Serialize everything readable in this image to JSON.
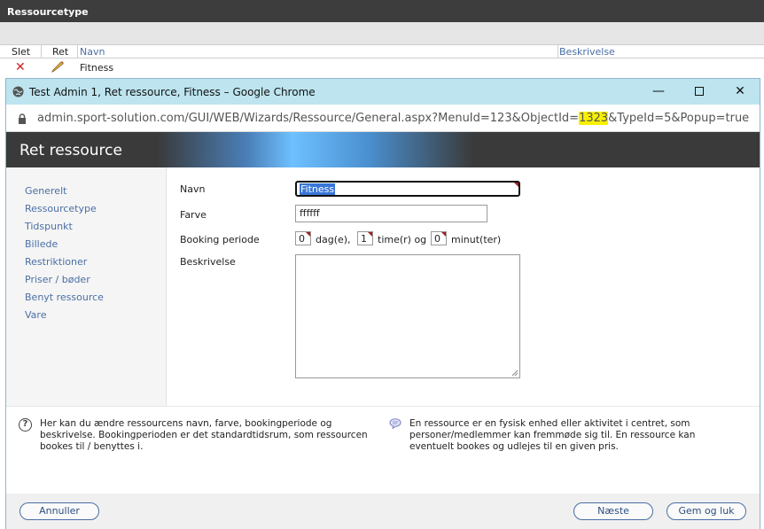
{
  "background": {
    "header_title": "Ressourcetype",
    "columns": {
      "slet": "Slet",
      "ret": "Ret",
      "navn": "Navn",
      "beskrivelse": "Beskrivelse"
    },
    "row": {
      "name": "Fitness"
    }
  },
  "window": {
    "title": "Test Admin 1, Ret ressource, Fitness – Google Chrome",
    "url_before": "admin.sport-solution.com/GUI/WEB/Wizards/Ressource/General.aspx?MenuId=123&ObjectId=",
    "url_highlight": "1323",
    "url_after": "&TypeId=5&Popup=true"
  },
  "modal": {
    "title": "Ret ressource",
    "nav": [
      "Generelt",
      "Ressourcetype",
      "Tidspunkt",
      "Billede",
      "Restriktioner",
      "Priser / bøder",
      "Benyt ressource",
      "Vare"
    ],
    "form": {
      "navn_label": "Navn",
      "navn_value": "Fitness",
      "farve_label": "Farve",
      "farve_value": "ffffff",
      "booking_label": "Booking periode",
      "days_value": "0",
      "days_unit": "dag(e),",
      "hours_value": "1",
      "hours_unit": "time(r) og",
      "minutes_value": "0",
      "minutes_unit": "minut(ter)",
      "beskrivelse_label": "Beskrivelse",
      "beskrivelse_value": ""
    },
    "help_text": "Her kan du ændre ressourcens navn, farve, bookingperiode og beskrivelse. Bookingperioden er det standardtidsrum, som ressourcen bookes til / benyttes i.",
    "info_text": "En ressource er en fysisk enhed eller aktivitet i centret, som personer/medlemmer kan fremmøde sig til. En ressource kan eventuelt bookes og udlejes til en given pris.",
    "buttons": {
      "cancel": "Annuller",
      "next": "Næste",
      "save_close": "Gem og luk"
    }
  },
  "colors": {
    "accent_link": "#4a6fa5",
    "titlebar": "#bde4ef",
    "url_highlight": "#f8f000",
    "delete_red": "#d02020"
  },
  "icons": [
    "delete-icon",
    "edit-pencil-icon",
    "globe-icon",
    "minimize-icon",
    "maximize-icon",
    "close-icon",
    "lock-icon",
    "help-icon",
    "speech-bubble-icon"
  ]
}
